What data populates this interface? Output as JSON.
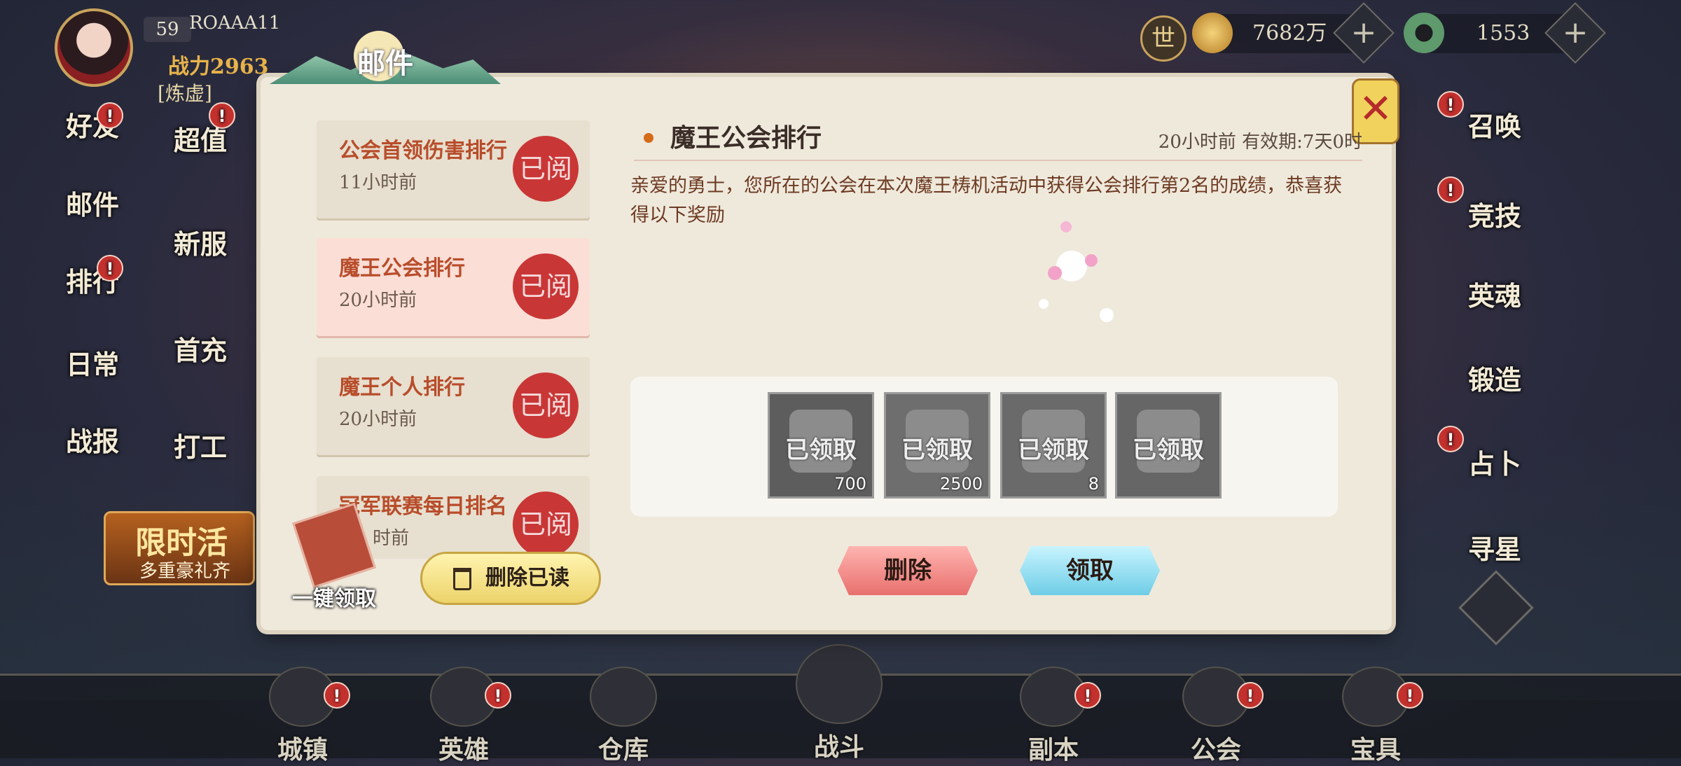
{
  "player": {
    "level": "59",
    "name": "ROAAA11",
    "power": "战力2963",
    "title": "[炼虚]"
  },
  "world_label": "世",
  "resources": [
    {
      "icon": "gold-coin-icon",
      "value": "7682万",
      "color": "#d9a23a"
    },
    {
      "icon": "jade-icon",
      "value": "1553",
      "color": "#5e9a6b"
    }
  ],
  "left_menu_col1": [
    {
      "label": "好友",
      "badge": "!"
    },
    {
      "label": "邮件",
      "badge": ""
    },
    {
      "label": "排行",
      "badge": "!"
    },
    {
      "label": "日常",
      "badge": ""
    },
    {
      "label": "战报",
      "badge": ""
    }
  ],
  "left_menu_col2": [
    {
      "label": "超值",
      "badge": "!"
    },
    {
      "label": "新服",
      "badge": ""
    },
    {
      "label": "首充",
      "badge": ""
    },
    {
      "label": "打工",
      "badge": ""
    }
  ],
  "event_banner": {
    "title": "限时活",
    "subtitle": "多重豪礼齐"
  },
  "right_menu": [
    {
      "label": "召唤",
      "badge": "!"
    },
    {
      "label": "竞技",
      "badge": "!"
    },
    {
      "label": "英魂",
      "badge": ""
    },
    {
      "label": "锻造",
      "badge": ""
    },
    {
      "label": "占卜",
      "badge": "!"
    },
    {
      "label": "寻星",
      "badge": ""
    }
  ],
  "bottom_nav": [
    {
      "label": "城镇",
      "badge": "!"
    },
    {
      "label": "英雄",
      "badge": "!"
    },
    {
      "label": "仓库",
      "badge": ""
    },
    {
      "label": "战斗",
      "badge": ""
    },
    {
      "label": "副本",
      "badge": "!"
    },
    {
      "label": "公会",
      "badge": "!"
    },
    {
      "label": "宝具",
      "badge": "!"
    }
  ],
  "mail": {
    "dialog_title": "邮件",
    "close_label": "✕",
    "read_stamp": "已阅",
    "items": [
      {
        "title": "公会首领伤害排行",
        "time": "11小时前"
      },
      {
        "title": "魔王公会排行",
        "time": "20小时前"
      },
      {
        "title": "魔王个人排行",
        "time": "20小时前"
      },
      {
        "title": "冠军联赛每日排名",
        "time": "时前"
      }
    ],
    "selected": {
      "title": "魔王公会排行",
      "meta": "20小时前  有效期:7天0时",
      "body": "亲爱的勇士，您所在的公会在本次魔王梼机活动中获得公会排行第2名的成绩，恭喜获得以下奖励"
    },
    "rewards": [
      {
        "icon": "winged-emblem-icon",
        "status": "已领取",
        "count": "700"
      },
      {
        "icon": "coin-pile-icon",
        "status": "已领取",
        "count": "2500"
      },
      {
        "icon": "potion-scroll-icon",
        "status": "已领取",
        "count": "8"
      },
      {
        "icon": "rune-card-icon",
        "status": "已领取",
        "count": ""
      }
    ],
    "claim_all_label": "一键领取",
    "delete_read_label": "删除已读",
    "delete_label": "删除",
    "claim_label": "领取"
  }
}
